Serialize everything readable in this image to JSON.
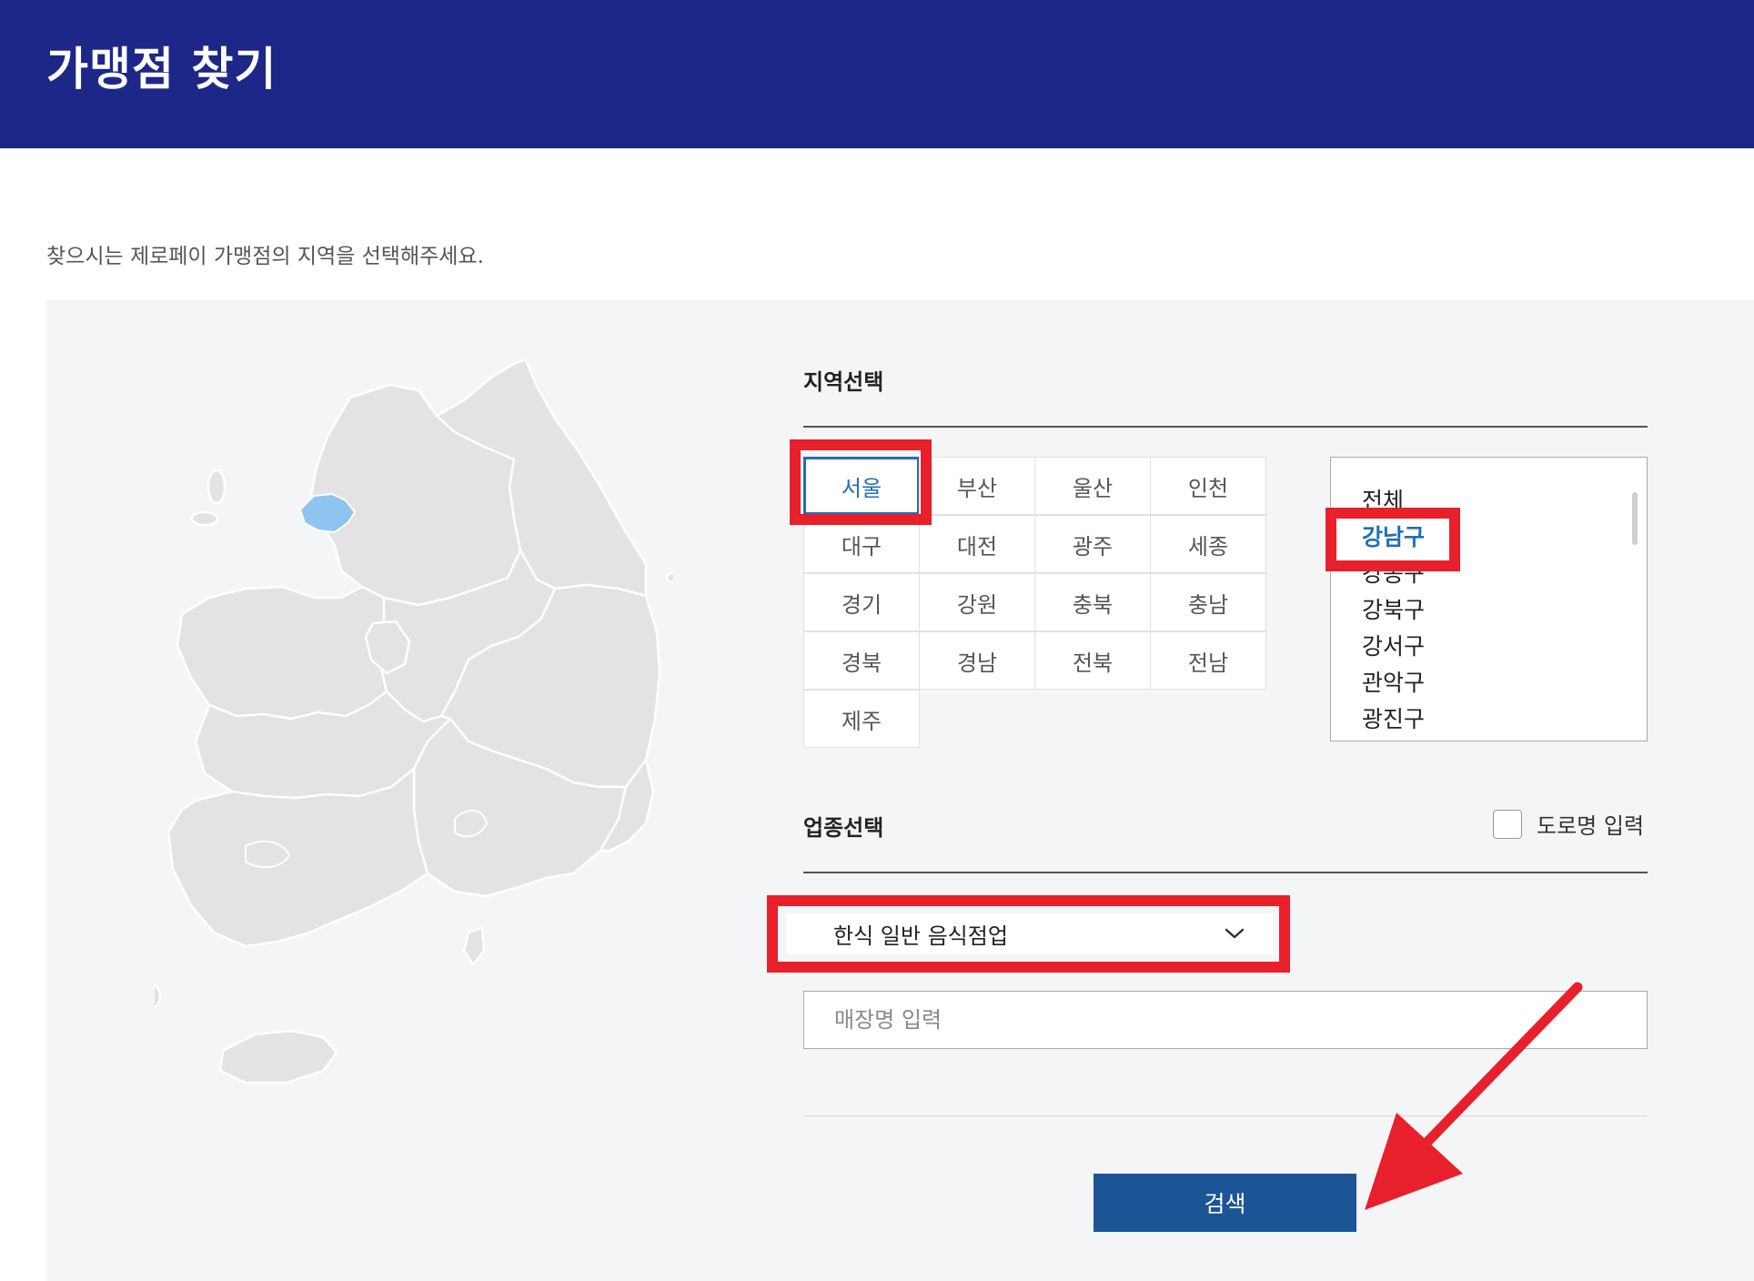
{
  "header": {
    "title": "가맹점 찾기"
  },
  "subtitle": "찾으시는 제로페이 가맹점의 지역을 선택해주세요.",
  "region_section": {
    "title": "지역선택",
    "regions": [
      "서울",
      "부산",
      "울산",
      "인천",
      "대구",
      "대전",
      "광주",
      "세종",
      "경기",
      "강원",
      "충북",
      "충남",
      "경북",
      "경남",
      "전북",
      "전남",
      "제주"
    ],
    "selected": "서울"
  },
  "district_list": {
    "items": [
      "전체",
      "강남구",
      "강동구",
      "강북구",
      "강서구",
      "관악구",
      "광진구"
    ],
    "selected": "강남구"
  },
  "business_section": {
    "title": "업종선택",
    "road_name_label": "도로명 입력",
    "category_value": "한식 일반 음식점업",
    "store_name_placeholder": "매장명 입력"
  },
  "search_button": {
    "label": "검색"
  },
  "colors": {
    "header_bg": "#1c2787",
    "accent_blue": "#1f6fb5",
    "button_bg": "#1b5596",
    "annotation_red": "#e8202b",
    "map_region": "#e3e3e3",
    "map_selected": "#8fc3f0"
  },
  "icons": {
    "dropdown": "chevron-down-icon",
    "annotation": "arrow-icon"
  }
}
